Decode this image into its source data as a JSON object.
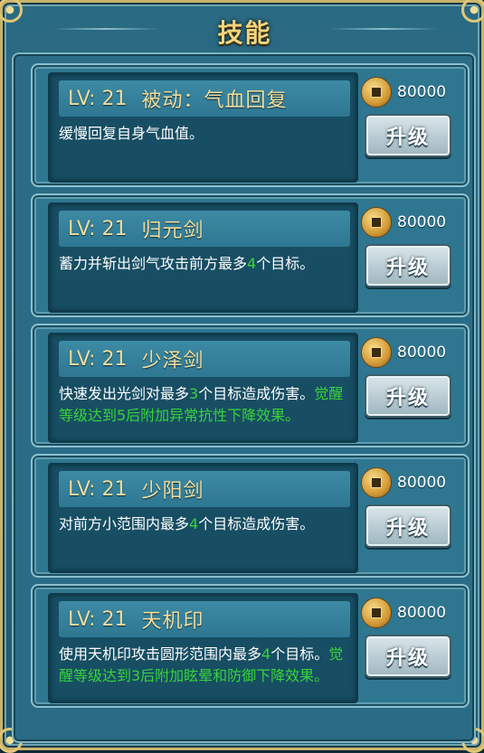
{
  "window": {
    "title": "技能"
  },
  "skills": [
    {
      "level": "LV: 21",
      "name": "被动：气血回复",
      "desc": [
        {
          "t": "缓慢回复自身气血值。"
        }
      ],
      "cost": "80000",
      "button": "升级"
    },
    {
      "level": "LV: 21",
      "name": "归元剑",
      "desc": [
        {
          "t": "蓄力并斩出剑气攻击前方最多"
        },
        {
          "t": "4",
          "hl": true
        },
        {
          "t": "个目标。"
        }
      ],
      "cost": "80000",
      "button": "升级"
    },
    {
      "level": "LV: 21",
      "name": "少泽剑",
      "desc": [
        {
          "t": "快速发出光剑对最多"
        },
        {
          "t": "3",
          "hl": true
        },
        {
          "t": "个目标造成伤害。"
        },
        {
          "t": "觉醒等级达到5后附加异常抗性下降效果。",
          "hl": true
        }
      ],
      "cost": "80000",
      "button": "升级"
    },
    {
      "level": "LV: 21",
      "name": "少阳剑",
      "desc": [
        {
          "t": "对前方小范围内最多"
        },
        {
          "t": "4",
          "hl": true
        },
        {
          "t": "个目标造成伤害。"
        }
      ],
      "cost": "80000",
      "button": "升级"
    },
    {
      "level": "LV: 21",
      "name": "天机印",
      "desc": [
        {
          "t": "使用天机印攻击圆形范围内最多"
        },
        {
          "t": "4",
          "hl": true
        },
        {
          "t": "个目标。"
        },
        {
          "t": "觉醒等级达到3后附加眩晕和防御下降效果。",
          "hl": true
        }
      ],
      "cost": "80000",
      "button": "升级"
    }
  ]
}
